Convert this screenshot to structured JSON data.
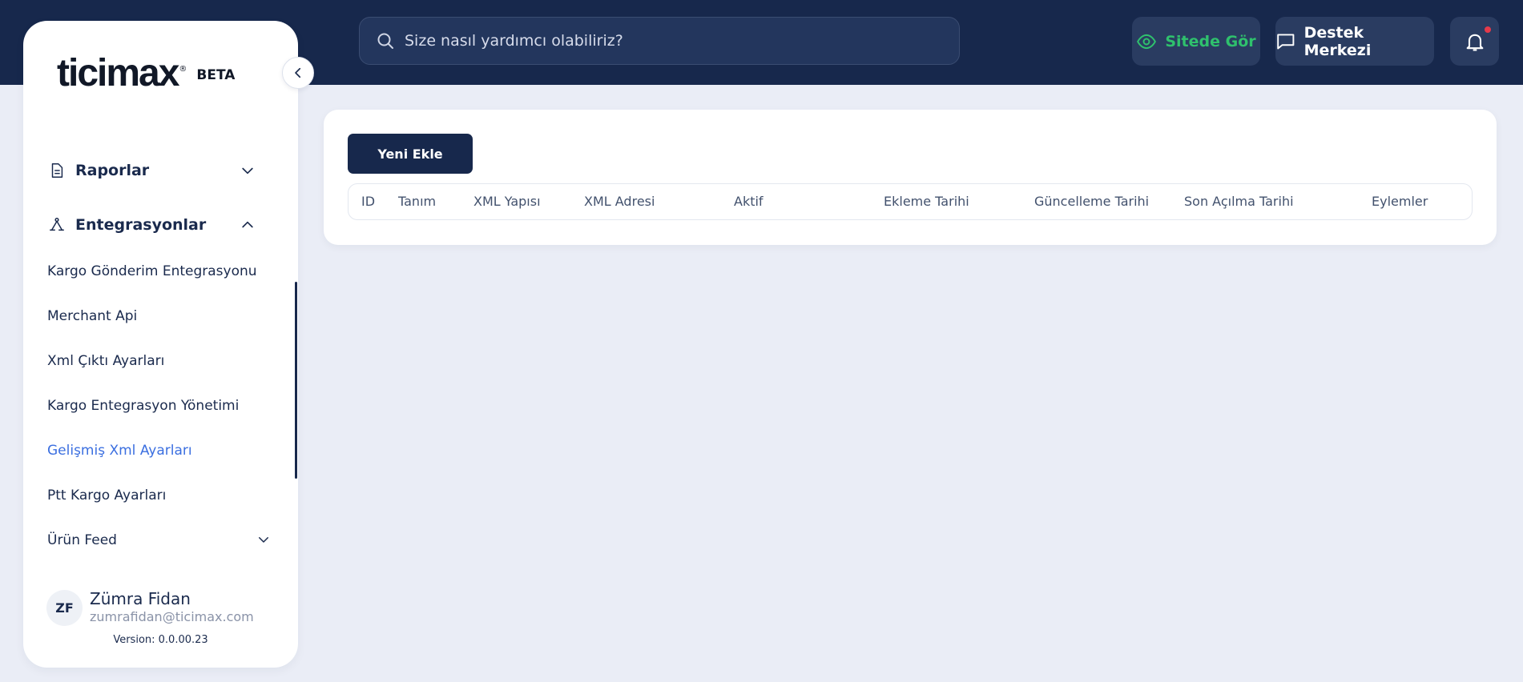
{
  "header": {
    "search_placeholder": "Size nasıl yardımcı olabiliriz?",
    "site_button": "Sitede Gör",
    "support_button": "Destek Merkezi",
    "notification_dot_color": "#e53a4a"
  },
  "sidebar": {
    "logo_text": "ticimax",
    "logo_reg": "®",
    "beta_label": "BETA",
    "groups": [
      {
        "label": "Raporlar",
        "icon": "document-icon",
        "expanded": false
      },
      {
        "label": "Entegrasyonlar",
        "icon": "integration-icon",
        "expanded": true
      }
    ],
    "sub_items": [
      {
        "label": "Kargo Gönderim Entegrasyonu"
      },
      {
        "label": "Merchant Api"
      },
      {
        "label": "Xml Çıktı Ayarları"
      },
      {
        "label": "Kargo Entegrasyon Yönetimi"
      },
      {
        "label": "Gelişmiş Xml Ayarları",
        "active": true
      },
      {
        "label": "Ptt Kargo Ayarları"
      },
      {
        "label": "Ürün Feed",
        "has_children": true
      }
    ],
    "user": {
      "initials": "ZF",
      "name": "Zümra Fidan",
      "email": "zumrafidan@ticimax.com"
    },
    "version": "Version: 0.0.00.23"
  },
  "main": {
    "add_button": "Yeni Ekle",
    "columns": [
      "ID",
      "Tanım",
      "XML Yapısı",
      "XML Adresi",
      "Aktif",
      "Ekleme Tarihi",
      "Güncelleme Tarihi",
      "Son Açılma Tarihi",
      "Eylemler"
    ]
  },
  "colors": {
    "primary": "#17284c",
    "accent_green": "#2fc16d",
    "active_link": "#3b6fe0",
    "background": "#eaedf6"
  }
}
